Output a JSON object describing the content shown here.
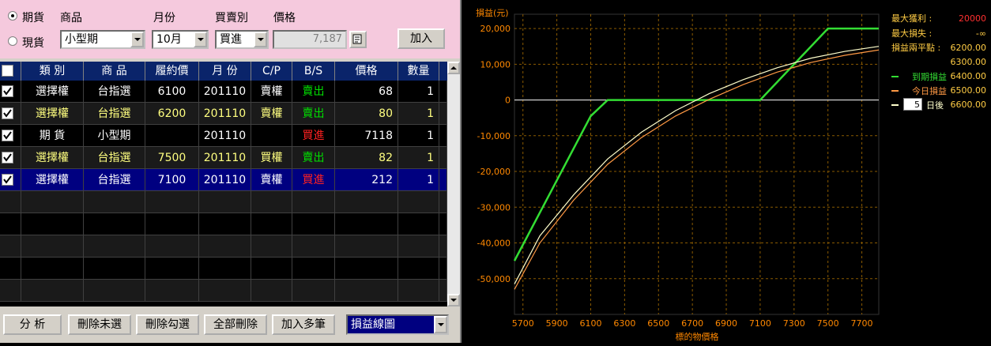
{
  "form": {
    "type_futures": "期貨",
    "type_spot": "現貨",
    "product_label": "商品",
    "month_label": "月份",
    "side_label": "買賣別",
    "price_label": "價格",
    "product_value": "小型期",
    "month_value": "10月",
    "side_value": "買進",
    "price_value": "7,187",
    "add_button": "加入"
  },
  "grid": {
    "headers": [
      "類 別",
      "商 品",
      "履約價",
      "月 份",
      "C/P",
      "B/S",
      "價格",
      "數量"
    ],
    "rows": [
      {
        "category": "選擇權",
        "product": "台指選",
        "strike": "6100",
        "month": "201110",
        "cp": "賣權",
        "bs": "賣出",
        "price": "68",
        "qty": "1",
        "checked": true
      },
      {
        "category": "選擇權",
        "product": "台指選",
        "strike": "6200",
        "month": "201110",
        "cp": "賣權",
        "bs": "賣出",
        "price": "80",
        "qty": "1",
        "checked": true
      },
      {
        "category": "期 貨",
        "product": "小型期",
        "strike": "",
        "month": "201110",
        "cp": "",
        "bs": "買進",
        "price": "7118",
        "qty": "1",
        "checked": true
      },
      {
        "category": "選擇權",
        "product": "台指選",
        "strike": "7500",
        "month": "201110",
        "cp": "買權",
        "bs": "賣出",
        "price": "82",
        "qty": "1",
        "checked": true
      },
      {
        "category": "選擇權",
        "product": "台指選",
        "strike": "7100",
        "month": "201110",
        "cp": "賣權",
        "bs": "買進",
        "price": "212",
        "qty": "1",
        "checked": true
      }
    ]
  },
  "buttons": {
    "analyze": "分 析",
    "delete_unchecked": "刪除未選",
    "delete_checked": "刪除勾選",
    "delete_all": "全部刪除",
    "add_multiple": "加入多筆",
    "view_select": "損益線圖"
  },
  "colors": {
    "sell": "#00e000",
    "buy": "#ff2020",
    "grid_yellow": "#ffff80",
    "grid_white": "#ffffff",
    "selected_row": "#000080",
    "expiry_line": "#33dd33",
    "today_line": "#ff9944",
    "days_line": "#ffffcc",
    "axis_label": "#ff8800",
    "grid_line": "#8a5a00"
  },
  "stats": {
    "max_profit_label": "最大獲利 :",
    "max_profit_value": "20000",
    "max_loss_label": "最大損失 :",
    "max_loss_value": "-∞",
    "breakeven_label": "損益兩平點 :",
    "breakeven_values": [
      "6200.00",
      "6300.00",
      "6400.00",
      "6500.00",
      "6600.00"
    ]
  },
  "legend": {
    "expiry": "到期損益",
    "today": "今日損益",
    "days_value": "5",
    "days_suffix": "日後"
  },
  "chart_data": {
    "type": "line",
    "ylabel": "損益(元)",
    "xlabel": "標的物價格",
    "x_ticks": [
      5700,
      5900,
      6100,
      6300,
      6500,
      6700,
      6900,
      7100,
      7300,
      7500,
      7700
    ],
    "y_ticks": [
      20000,
      10000,
      0,
      -10000,
      -20000,
      -30000,
      -40000,
      -50000
    ],
    "y_tick_labels": [
      "20,000",
      "10,000",
      "0",
      "-10,000",
      "-20,000",
      "-30,000",
      "-40,000",
      "-50,000"
    ],
    "xlim": [
      5650,
      7800
    ],
    "ylim": [
      -60000,
      24000
    ],
    "grid": true,
    "series": [
      {
        "name": "到期損益",
        "color": "#33dd33",
        "points": [
          [
            5650,
            -45000
          ],
          [
            6100,
            -4500
          ],
          [
            6200,
            0
          ],
          [
            7100,
            0
          ],
          [
            7500,
            20000
          ],
          [
            7800,
            20000
          ]
        ]
      },
      {
        "name": "今日損益",
        "color": "#ff9944",
        "points": [
          [
            5650,
            -53000
          ],
          [
            5800,
            -40000
          ],
          [
            6000,
            -28000
          ],
          [
            6200,
            -18000
          ],
          [
            6400,
            -10500
          ],
          [
            6600,
            -4500
          ],
          [
            6800,
            200
          ],
          [
            7000,
            4300
          ],
          [
            7200,
            7800
          ],
          [
            7400,
            10500
          ],
          [
            7600,
            12500
          ],
          [
            7800,
            14000
          ]
        ]
      },
      {
        "name": "5日後",
        "color": "#ffffcc",
        "points": [
          [
            5650,
            -51500
          ],
          [
            5800,
            -38000
          ],
          [
            6000,
            -26500
          ],
          [
            6200,
            -16500
          ],
          [
            6400,
            -9000
          ],
          [
            6600,
            -3000
          ],
          [
            6800,
            1800
          ],
          [
            7000,
            5700
          ],
          [
            7200,
            9000
          ],
          [
            7400,
            11700
          ],
          [
            7600,
            13600
          ],
          [
            7800,
            15000
          ]
        ]
      }
    ]
  }
}
